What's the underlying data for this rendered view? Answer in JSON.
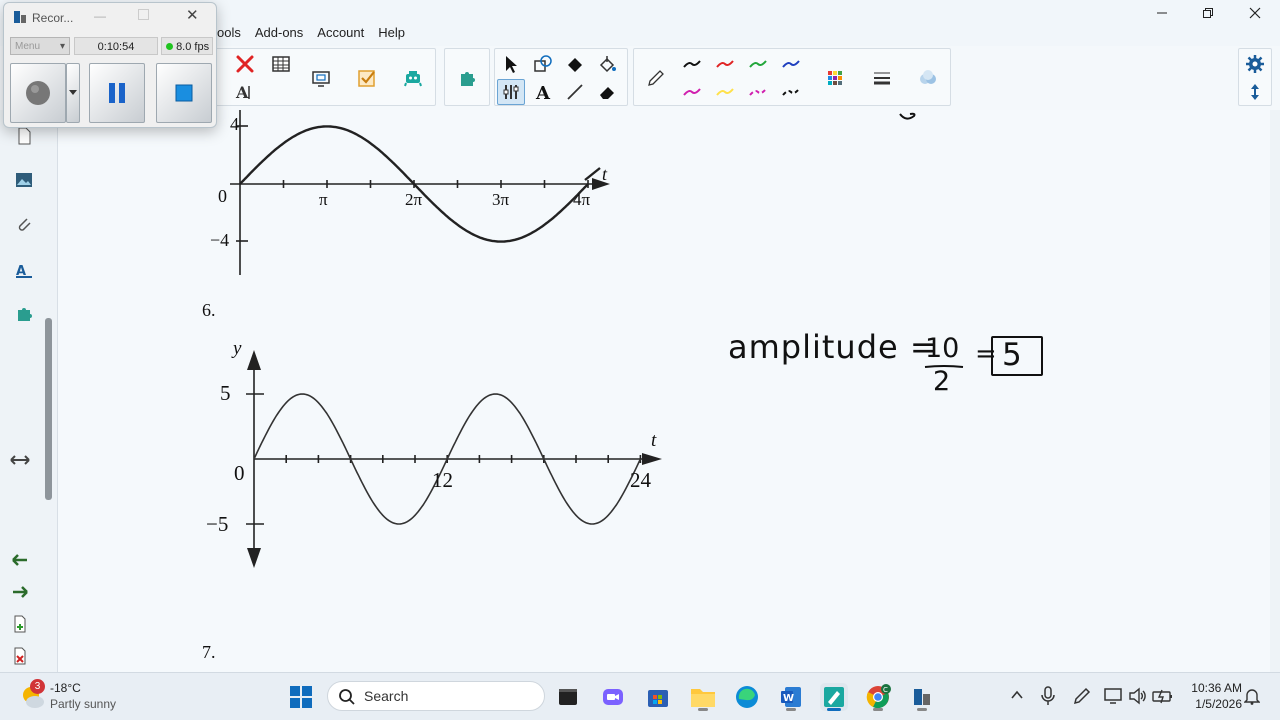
{
  "window": {
    "menu": [
      "ools",
      "Add-ons",
      "Account",
      "Help"
    ]
  },
  "recorder": {
    "title": "Recor...",
    "menu_label": "Menu",
    "elapsed": "0:10:54",
    "fps": "8.0 fps"
  },
  "canvas": {
    "graph5": {
      "y_ticks": [
        "4",
        "0",
        "−4"
      ],
      "x_ticks": [
        "π",
        "2π",
        "3π",
        "4π"
      ],
      "x_axis_label": "t"
    },
    "problem6": {
      "number": "6.",
      "y_axis_label": "y",
      "x_axis_label": "t",
      "y_ticks": [
        "5",
        "0",
        "−5"
      ],
      "x_ticks": [
        "12",
        "24"
      ],
      "annotation": {
        "lhs": "amplitude =",
        "numerator": "10",
        "denominator": "2",
        "equals": "=",
        "result": "5"
      }
    },
    "problem7": {
      "number": "7."
    }
  },
  "taskbar": {
    "weather": {
      "badge": "3",
      "temp": "-18°C",
      "condition": "Partly sunny"
    },
    "search_placeholder": "Search",
    "time": "10:36 AM",
    "date": "1/5/2026"
  },
  "icons": {
    "colors": {
      "pen_black": "#111111",
      "pen_red": "#e02424",
      "pen_green": "#22a63a",
      "pen_blue": "#1f3fbf",
      "pen_magenta": "#d01fae",
      "pen_yellow": "#ffe14a",
      "accent": "#0f6cbd"
    }
  }
}
